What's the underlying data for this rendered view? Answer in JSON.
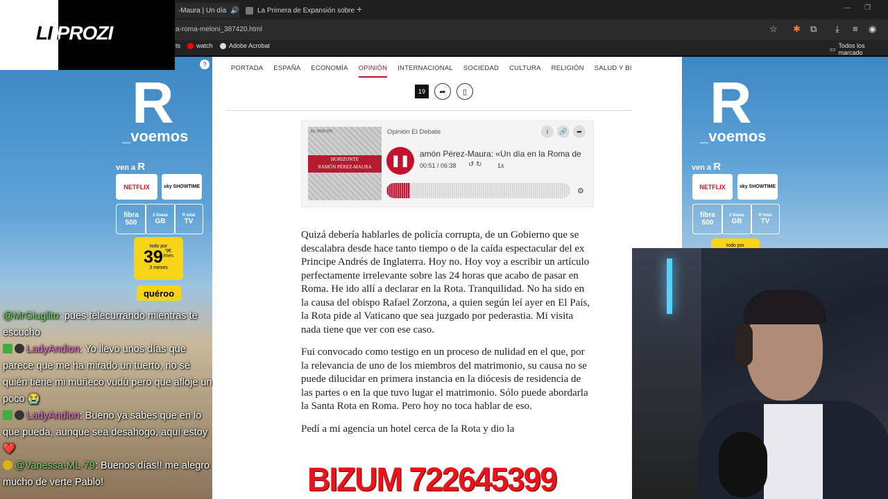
{
  "browser": {
    "tabs": [
      {
        "title": "-Maura | Un día",
        "active": true
      },
      {
        "title": "La Primera de Expansión sobre",
        "active": false
      }
    ],
    "new_tab": "+",
    "url": "a-roma-meloni_387420.html",
    "bookmarks": [
      "watch",
      "Adobe Acrobat"
    ],
    "bookmarks_right": "Todos los marcado",
    "bookmark_partial": "ts"
  },
  "site": {
    "nav": [
      "PORTADA",
      "ESPAÑA",
      "ECONOMÍA",
      "OPINIÓN",
      "INTERNACIONAL",
      "SOCIEDAD",
      "CULTURA",
      "RELIGIÓN",
      "SALUD Y BIENESTAR"
    ],
    "active_nav": "OPINIÓN",
    "comment_count": "19"
  },
  "player": {
    "source": "Opinión El Debate",
    "title": "amón Pérez-Maura: «Un día en la Roma de",
    "time": "00:51 / 06:38",
    "speed": "1x",
    "progress": 0.13,
    "thumb_banner_line1": "HORIZONTE",
    "thumb_banner_line2": "RAMÓN PÉREZ-MAURA",
    "thumb_tag": "EL DEBATE"
  },
  "article": {
    "paragraphs": [
      "Quizá debería hablarles de policía corrupta, de un Gobierno que se descalabra desde hace tanto tiempo o de la caída espectacular del ex Principe Andrés de Inglaterra. Hoy no. Hoy voy a escribir un artículo perfectamente irrelevante sobre las 24 horas que acabo de pasar en Roma. He ido allí a declarar en la Rota. Tranquilidad. No ha sido en la causa del obispo Rafael Zorzona, a quien según leí ayer en El País, la Rota pide al Vaticano que sea juzgado por pederastia. Mi visita nada tiene que ver con ese caso.",
      "Fui convocado como testigo en un proceso de nulidad en el que, por la relevancia de uno de los miembros del matrimonio, su causa no se puede dilucidar en primera instancia en la diócesis de residencia de las partes o en la que tuvo lugar el matrimonio. Sólo puede abordarla la Santa Rota en Roma. Pero hoy no toca hablar de eso.",
      "Pedí a mi agencia un hotel cerca de la Rota y dio la"
    ]
  },
  "ads": {
    "logo_letter": "R",
    "tagline": "_voemos",
    "ven_a": "ven a",
    "ven_a_brand": "R",
    "netflix": "NETFLIX",
    "skyshowtime": "sky SHOWTIME",
    "fibra_top": "fibra",
    "fibra_bottom": "500",
    "gb_top": "2 líneas",
    "gb_bottom": "GB",
    "tv_top": "R total",
    "tv_bottom": "TV",
    "price_label": "todo por",
    "price_main": "39",
    "price_decimals": "'9€",
    "price_unit": "/mes",
    "price_duration": "3 meses",
    "cta": "quéroo",
    "help_icon": "?"
  },
  "streamer": {
    "logo_text": "LI PROZI",
    "chat": [
      {
        "user": "@MrGiuglito",
        "color": "green",
        "text": ": pues telecurrando mientras te escucho",
        "badges": 0
      },
      {
        "user": "LadyAndion",
        "color": "pink",
        "text": ": Yo llevo unos días que parece que me ha mirado un tuerto, no sé quién tiene mi muñeco vudú pero que afloje un poco 😭",
        "badges": 2
      },
      {
        "user": "LadyAndion",
        "color": "pink",
        "text": ": Bueno ya sabes que en lo que pueda, aunque sea desahogo, aquí estoy ❤️",
        "badges": 2
      },
      {
        "user": "@Vanessa-ML-79",
        "color": "green",
        "text": ": Buenos días!! me alegro mucho de verte Pablo!",
        "badges": 1
      }
    ],
    "bizum": "BIZUM 722645399"
  }
}
